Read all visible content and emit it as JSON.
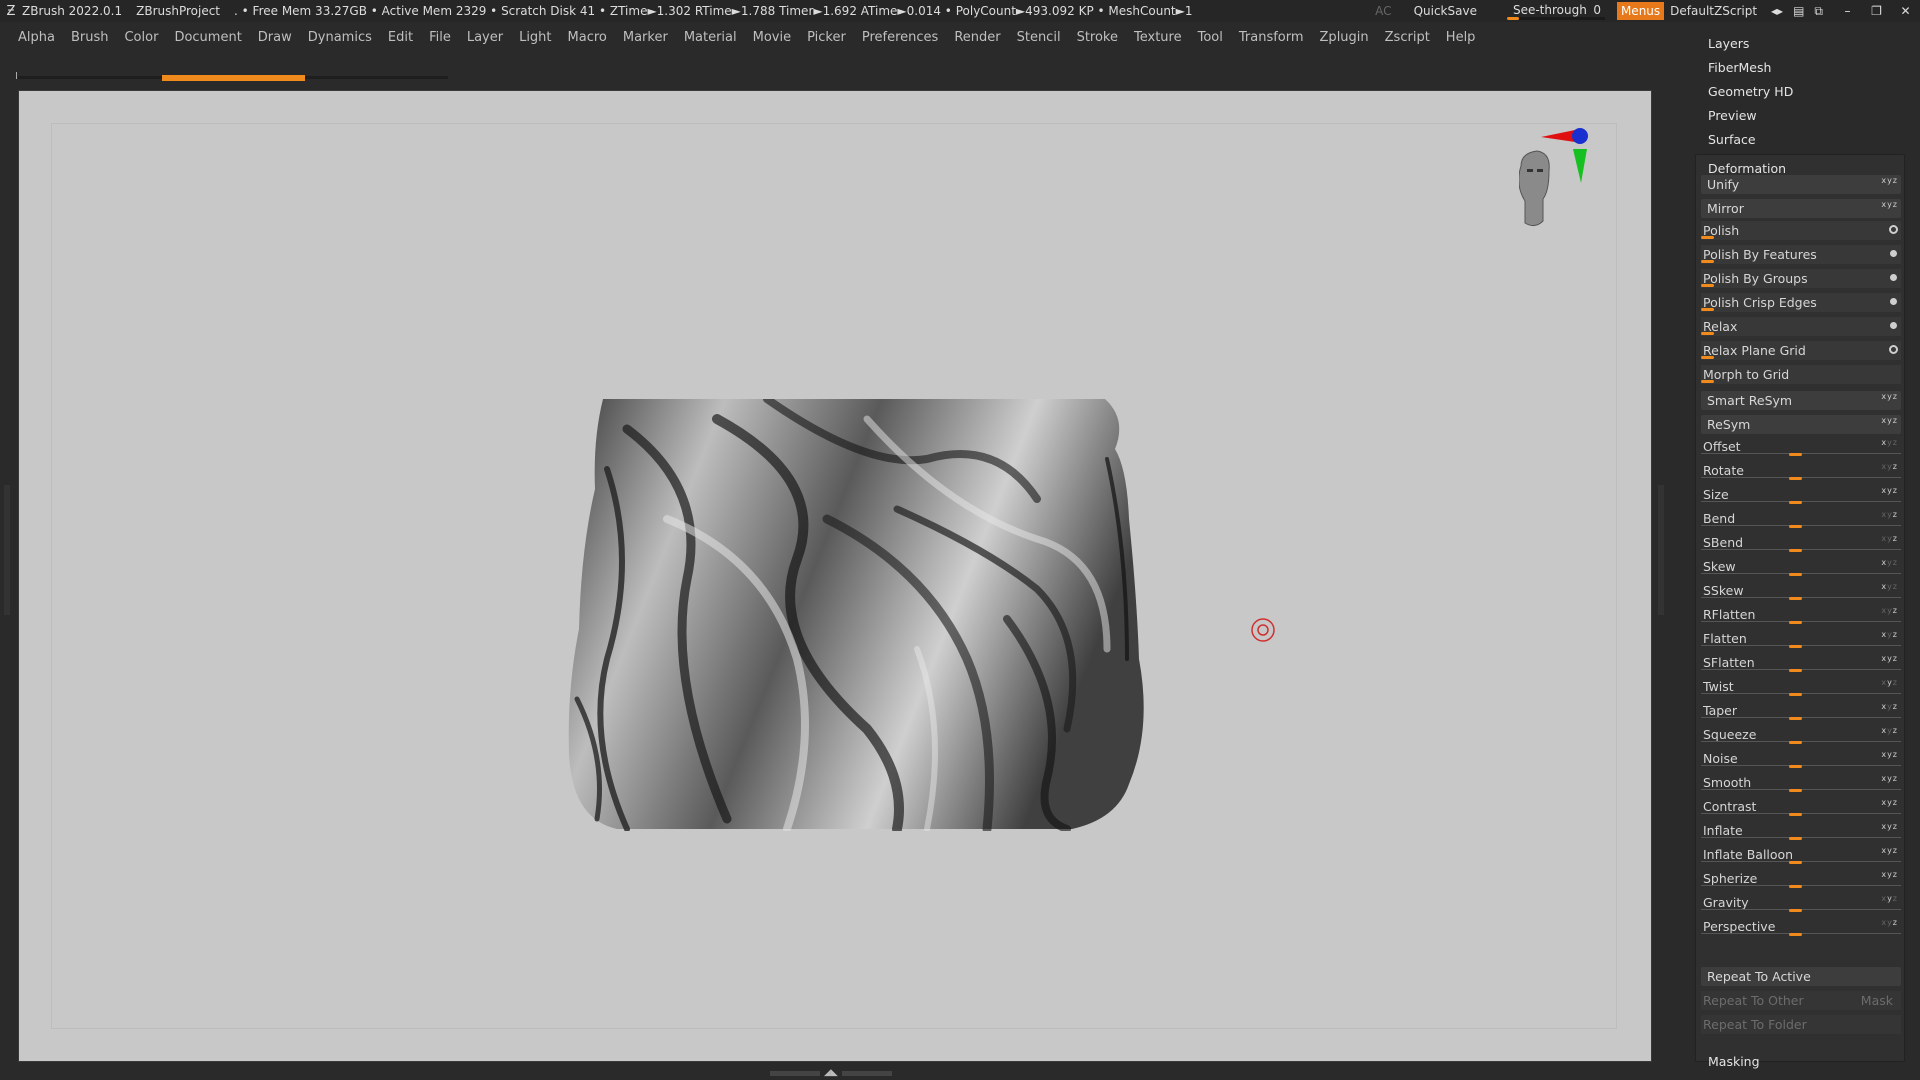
{
  "titlebar": {
    "app": "ZBrush 2022.0.1",
    "project": "ZBrushProject",
    "stats": ". • Free Mem 33.27GB • Active Mem 2329 • Scratch Disk 41 • ZTime►1.302 RTime►1.788 Timer►1.692 ATime►0.014 • PolyCount►493.092 KP • MeshCount►1",
    "ac": "AC",
    "quicksave": "QuickSave",
    "see_through_label": "See-through",
    "see_through_value": "0",
    "menus": "Menus",
    "script": "DefaultZScript"
  },
  "menubar": [
    "Alpha",
    "Brush",
    "Color",
    "Document",
    "Draw",
    "Dynamics",
    "Edit",
    "File",
    "Layer",
    "Light",
    "Macro",
    "Marker",
    "Material",
    "Movie",
    "Picker",
    "Preferences",
    "Render",
    "Stencil",
    "Stroke",
    "Texture",
    "Tool",
    "Transform",
    "Zplugin",
    "Zscript",
    "Help"
  ],
  "panel": {
    "headers": [
      "Layers",
      "FiberMesh",
      "Geometry HD",
      "Preview",
      "Surface"
    ],
    "deformation_title": "Deformation",
    "buttons": [
      {
        "label": "Unify",
        "axes": "xyz"
      },
      {
        "label": "Mirror",
        "axes": "xyz"
      }
    ],
    "toggles": [
      {
        "label": "Polish",
        "mark": "ring"
      },
      {
        "label": "Polish By Features",
        "mark": "dot"
      },
      {
        "label": "Polish By Groups",
        "mark": "dot"
      },
      {
        "label": "Polish Crisp Edges",
        "mark": "dot"
      },
      {
        "label": "Relax",
        "mark": "dot"
      },
      {
        "label": "Relax Plane Grid",
        "mark": "ring"
      },
      {
        "label": "Morph to Grid",
        "mark": ""
      }
    ],
    "buttons2": [
      {
        "label": "Smart ReSym",
        "axes": "xyz"
      },
      {
        "label": "ReSym",
        "axes": "xyz"
      }
    ],
    "sliders": [
      {
        "label": "Offset",
        "axes": "x.."
      },
      {
        "label": "Rotate",
        "axes": "..z"
      },
      {
        "label": "Size",
        "axes": "xyz"
      },
      {
        "label": "Bend",
        "axes": "..z"
      },
      {
        "label": "SBend",
        "axes": "..z"
      },
      {
        "label": "Skew",
        "axes": "x.."
      },
      {
        "label": "SSkew",
        "axes": "x.."
      },
      {
        "label": "RFlatten",
        "axes": "..z"
      },
      {
        "label": "Flatten",
        "axes": "x.z"
      },
      {
        "label": "SFlatten",
        "axes": "xyz"
      },
      {
        "label": "Twist",
        "axes": ".y."
      },
      {
        "label": "Taper",
        "axes": "x.z"
      },
      {
        "label": "Squeeze",
        "axes": "x.z"
      },
      {
        "label": "Noise",
        "axes": "xyz"
      },
      {
        "label": "Smooth",
        "axes": "xyz"
      },
      {
        "label": "Contrast",
        "axes": "xyz"
      },
      {
        "label": "Inflate",
        "axes": "xyz"
      },
      {
        "label": "Inflate Balloon",
        "axes": "xyz"
      },
      {
        "label": "Spherize",
        "axes": "xyz"
      },
      {
        "label": "Gravity",
        "axes": ".y."
      },
      {
        "label": "Perspective",
        "axes": "..z"
      }
    ],
    "repeat_active": "Repeat To Active",
    "repeat_other": "Repeat To Other",
    "mask": "Mask",
    "repeat_folder": "Repeat To Folder",
    "masking": "Masking"
  },
  "colors": {
    "accent": "#f08a1c",
    "canvas": "#c8c8c8",
    "panel": "#2a2a2a"
  },
  "icons": [
    "zbrush-logo-icon",
    "head-orientation-icon",
    "axis-gizmo-icon",
    "cursor-target-icon"
  ]
}
